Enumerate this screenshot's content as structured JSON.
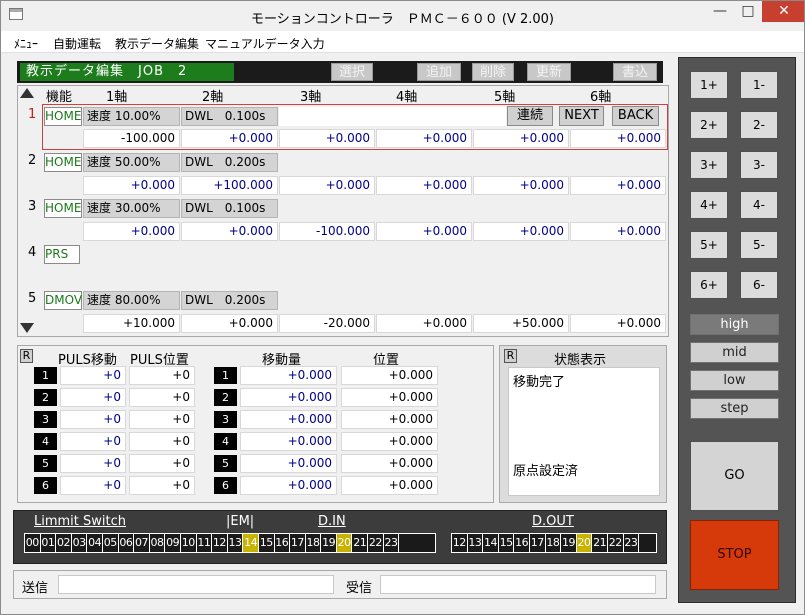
{
  "window": {
    "title": "モーションコントローラ　ＰＭＣ－６００ (V 2.00)",
    "minimize": "—",
    "maximize": "□",
    "close": "✕"
  },
  "menu": [
    "ﾒﾆｭｰ",
    "自動運転",
    "教示データ編集",
    "マニュアルデータ入力"
  ],
  "editor": {
    "header": "教示データ編集　JOB　2",
    "buttons": [
      "選択",
      "追加",
      "削除",
      "更新",
      "書込"
    ],
    "col_headers": [
      "機能",
      "1軸",
      "2軸",
      "3軸",
      "4軸",
      "5軸",
      "6軸"
    ],
    "row_actions": [
      "連続",
      "NEXT",
      "BACK"
    ],
    "rows": [
      {
        "num": "1",
        "func": "HOME",
        "speed": "速度 10.00%",
        "dwl": "DWL　0.100s",
        "values": [
          "-100.000",
          "+0.000",
          "+0.000",
          "+0.000",
          "+0.000",
          "+0.000"
        ]
      },
      {
        "num": "2",
        "func": "HOME",
        "speed": "速度 50.00%",
        "dwl": "DWL　0.200s",
        "values": [
          "+0.000",
          "+100.000",
          "+0.000",
          "+0.000",
          "+0.000",
          "+0.000"
        ]
      },
      {
        "num": "3",
        "func": "HOME",
        "speed": "速度 30.00%",
        "dwl": "DWL　0.100s",
        "values": [
          "+0.000",
          "+0.000",
          "-100.000",
          "+0.000",
          "+0.000",
          "+0.000"
        ]
      },
      {
        "num": "4",
        "func": "PRS"
      },
      {
        "num": "5",
        "func": "DMOV",
        "speed": "速度 80.00%",
        "dwl": "DWL　0.200s",
        "values": [
          "+10.000",
          "+0.000",
          "-20.000",
          "+0.000",
          "+50.000",
          "+0.000"
        ]
      }
    ]
  },
  "pulse": {
    "tag": "R",
    "h1": "PULS移動",
    "h2": "PULS位置",
    "h3": "移動量",
    "h4": "位置",
    "rows": [
      {
        "n": "1",
        "pm": "+0",
        "pp": "+0",
        "mv": "+0.000",
        "pos": "+0.000"
      },
      {
        "n": "2",
        "pm": "+0",
        "pp": "+0",
        "mv": "+0.000",
        "pos": "+0.000"
      },
      {
        "n": "3",
        "pm": "+0",
        "pp": "+0",
        "mv": "+0.000",
        "pos": "+0.000"
      },
      {
        "n": "4",
        "pm": "+0",
        "pp": "+0",
        "mv": "+0.000",
        "pos": "+0.000"
      },
      {
        "n": "5",
        "pm": "+0",
        "pp": "+0",
        "mv": "+0.000",
        "pos": "+0.000"
      },
      {
        "n": "6",
        "pm": "+0",
        "pp": "+0",
        "mv": "+0.000",
        "pos": "+0.000"
      }
    ]
  },
  "status": {
    "tag": "R",
    "title": "状態表示",
    "line1": "移動完了",
    "line2": "原点設定済"
  },
  "io": {
    "limit_label": "Limmit Switch",
    "em_label": "|EM|",
    "din_label": "D.IN",
    "dout_label": "D.OUT",
    "din": [
      "00",
      "01",
      "02",
      "03",
      "04",
      "05",
      "06",
      "07",
      "08",
      "09",
      "10",
      "11",
      "12",
      "13",
      "14",
      "15",
      "16",
      "17",
      "18",
      "19",
      "20",
      "21",
      "22",
      "23"
    ],
    "din_on": [
      "14",
      "20"
    ],
    "dout": [
      "12",
      "13",
      "14",
      "15",
      "16",
      "17",
      "18",
      "19",
      "20",
      "21",
      "22",
      "23"
    ],
    "dout_on": [
      "20"
    ],
    "on_color": "#c8b400"
  },
  "comm": {
    "send": "送信",
    "recv": "受信"
  },
  "jog": {
    "buttons": [
      [
        "1+",
        "1-"
      ],
      [
        "2+",
        "2-"
      ],
      [
        "3+",
        "3-"
      ],
      [
        "4+",
        "4-"
      ],
      [
        "5+",
        "5-"
      ],
      [
        "6+",
        "6-"
      ]
    ],
    "speeds": [
      "high",
      "mid",
      "low",
      "step"
    ],
    "active_speed": "high",
    "go": "GO",
    "stop": "STOP",
    "stop_color": "#d63a0a"
  }
}
